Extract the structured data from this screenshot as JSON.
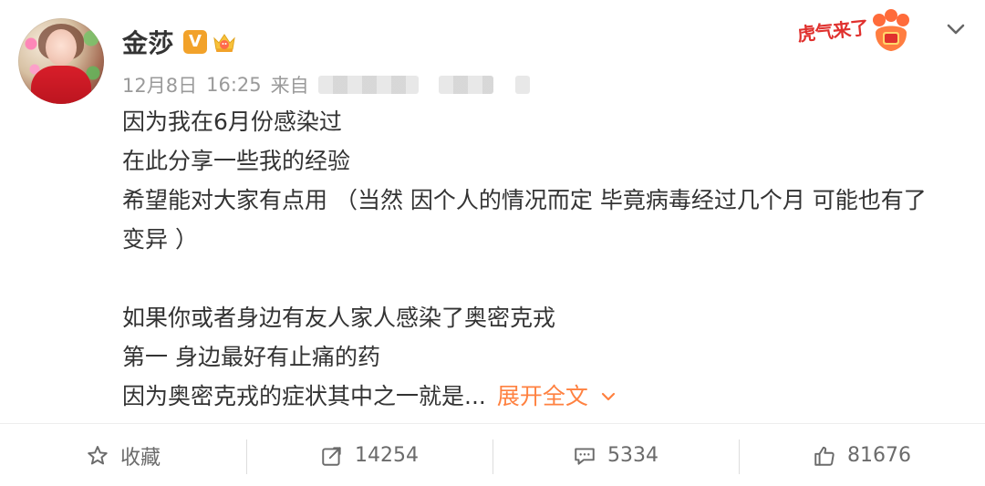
{
  "post": {
    "author": "金莎",
    "verified_badge": "V",
    "meta": {
      "date": "12月8日",
      "time": "16:25",
      "source_prefix": "来自"
    },
    "promo_text": "虎气来了",
    "lines": [
      "因为我在6月份感染过",
      "在此分享一些我的经验",
      "希望能对大家有点用 （当然 因个人的情况而定 毕竟病毒经过几个月 可能也有了",
      "变异 ）",
      "",
      "如果你或者身边有友人家人感染了奥密克戎",
      "第一 身边最好有止痛的药",
      "因为奥密克戎的症状其中之一就是..."
    ],
    "expand_label": "展开全文"
  },
  "actions": {
    "favorite_label": "收藏",
    "repost_count": "14254",
    "comment_count": "5334",
    "like_count": "81676"
  },
  "colors": {
    "accent_orange": "#ff8140",
    "verified": "#f2a22a",
    "promo_red": "#e0312e",
    "text": "#333333",
    "muted": "#9a9a9a"
  },
  "icons": {
    "more": "chevron-down-icon",
    "favorite": "star-outline-icon",
    "repost": "share-arrow-icon",
    "comment": "comment-bubble-icon",
    "like": "thumbs-up-icon"
  }
}
